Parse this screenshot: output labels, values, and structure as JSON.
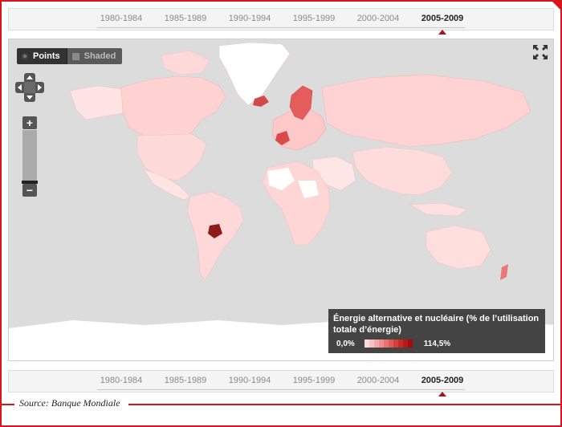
{
  "timeline": {
    "periods": [
      "1980-1984",
      "1985-1989",
      "1990-1994",
      "1995-1999",
      "2000-2004",
      "2005-2009"
    ],
    "active": "2005-2009"
  },
  "controls": {
    "points_label": "Points",
    "shaded_label": "Shaded",
    "zoom_in": "+",
    "zoom_out": "−"
  },
  "legend": {
    "title": "Énergie alternative et nucléaire (% de l’utilisation totale d’énergie)",
    "min_label": "0,0%",
    "max_label": "114,5%",
    "ramp_colors": [
      "#fbdada",
      "#f7c2c2",
      "#f3a9a9",
      "#ee8f8f",
      "#e87373",
      "#e05858",
      "#d63e3e",
      "#c92828",
      "#b81818",
      "#a30d0d"
    ]
  },
  "map": {
    "ocean_color": "#dcdcdc",
    "land_color": "#ffe4e4",
    "nodata_color": "#ffffff"
  },
  "source": "Source: Banque Mondiale"
}
